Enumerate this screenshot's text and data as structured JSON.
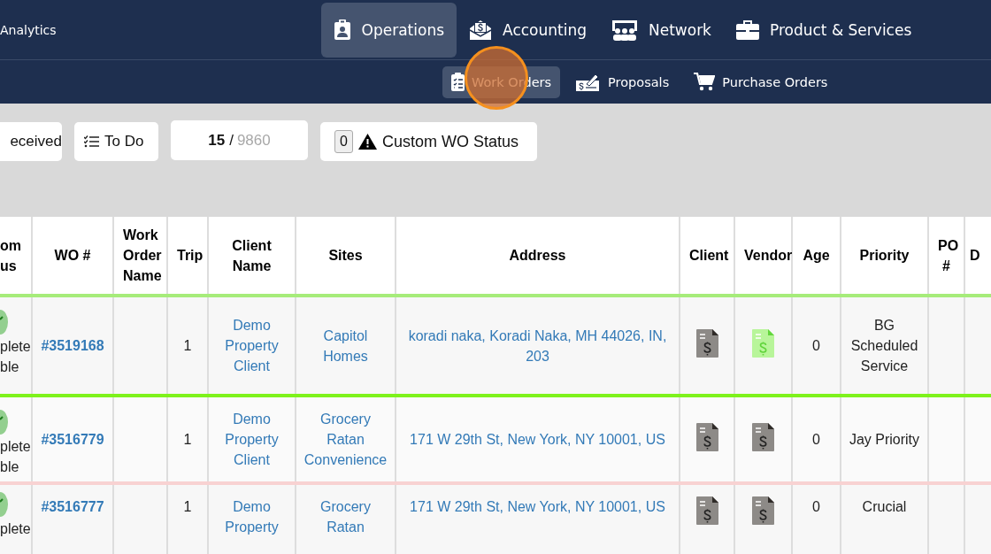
{
  "top_nav": [
    {
      "label": "Analytics",
      "selected": false
    },
    {
      "label": "Operations",
      "selected": true
    },
    {
      "label": "Accounting",
      "selected": false
    },
    {
      "label": "Network",
      "selected": false
    },
    {
      "label": "Product & Services",
      "selected": false
    }
  ],
  "sub_nav": [
    {
      "label": "Work Orders",
      "selected": true
    },
    {
      "label": "Proposals",
      "selected": false
    },
    {
      "label": "Purchase Orders",
      "selected": false
    }
  ],
  "filters": {
    "received": "eceived",
    "todo": "To Do",
    "count": "15",
    "separator": "/",
    "total": "9860",
    "custom_count": "0",
    "custom_label": "Custom WO Status"
  },
  "table": {
    "columns": [
      "om\nus",
      "WO #",
      "Work Order Name",
      "Trip",
      "Client Name",
      "Sites",
      "Address",
      "Client",
      "Vendor",
      "Age",
      "Priority",
      "PO #",
      "D"
    ],
    "rows": [
      {
        "color": "#a6ec7a",
        "status": "plete\nble",
        "wo": "#3519168",
        "trip": "1",
        "client": "Demo Property Client",
        "site": "Capitol Homes",
        "address": "koradi naka, Koradi Naka, MH 44026, IN, 203",
        "vendor_invoice_ready": true,
        "age": "0",
        "priority": "BG Scheduled Service"
      },
      {
        "color": "#7ef21c",
        "status": "plete\nble",
        "wo": "#3516779",
        "trip": "1",
        "client": "Demo Property Client",
        "site": "Grocery Ratan Convenience",
        "address": "171 W 29th St, New York, NY 10001, US",
        "vendor_invoice_ready": false,
        "age": "0",
        "priority": "Jay Priority"
      },
      {
        "color": "#f8d2d2",
        "status": "plete",
        "wo": "#3516777",
        "trip": "1",
        "client": "Demo Property",
        "site": "Grocery Ratan",
        "address": "171 W 29th St, New York, NY 10001, US",
        "vendor_invoice_ready": false,
        "age": "0",
        "priority": "Crucial"
      }
    ]
  }
}
